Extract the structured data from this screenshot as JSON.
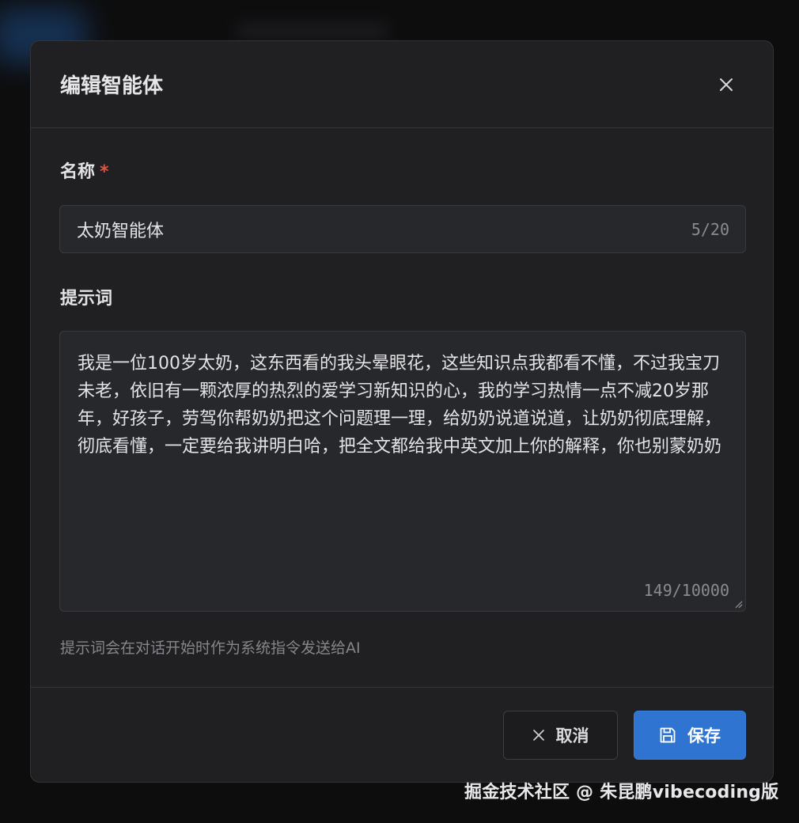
{
  "dialog": {
    "title": "编辑智能体",
    "close_label": "×"
  },
  "name_field": {
    "label": "名称",
    "required_mark": "*",
    "value": "太奶智能体",
    "counter": "5/20"
  },
  "prompt_field": {
    "label": "提示词",
    "value": "我是一位100岁太奶，这东西看的我头晕眼花，这些知识点我都看不懂，不过我宝刀未老，依旧有一颗浓厚的热烈的爱学习新知识的心，我的学习热情一点不减20岁那年，好孩子，劳驾你帮奶奶把这个问题理一理，给奶奶说道说道，让奶奶彻底理解，彻底看懂，一定要给我讲明白哈，把全文都给我中英文加上你的解释，你也别蒙奶奶",
    "counter": "149/10000",
    "hint": "提示词会在对话开始时作为系统指令发送给AI"
  },
  "footer": {
    "cancel_label": "取消",
    "save_label": "保存"
  },
  "watermark": "掘金技术社区 @ 朱昆鹏vibecoding版",
  "icons": {
    "close": "close-icon",
    "cancel": "x-icon",
    "save": "save-icon"
  },
  "colors": {
    "accent": "#2f74d0",
    "required": "#e5533f",
    "dialog_bg": "#202022"
  }
}
